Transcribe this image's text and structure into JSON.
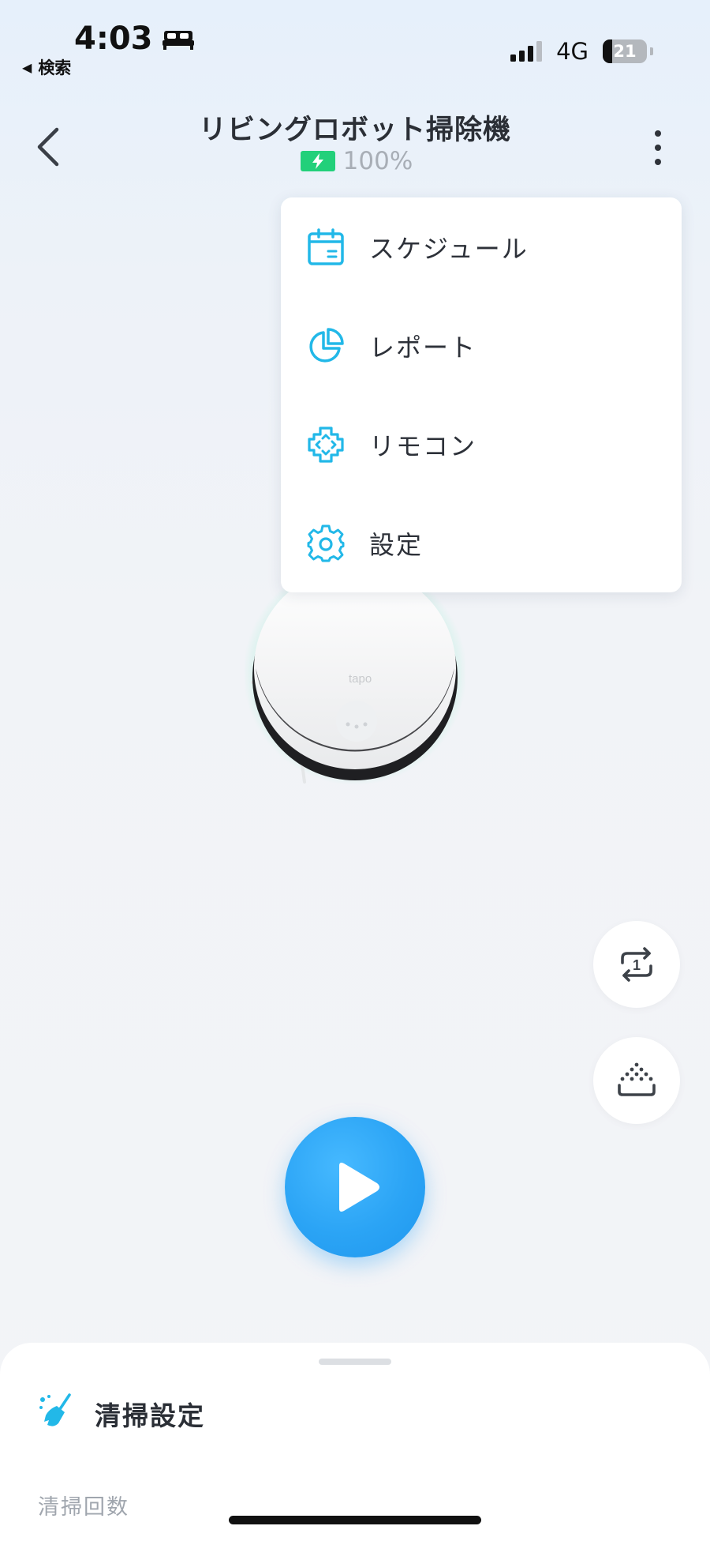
{
  "status_bar": {
    "time": "4:03",
    "back_app_label": "検索",
    "network": "4G",
    "battery_level": "21"
  },
  "header": {
    "title": "リビングロボット掃除機",
    "battery_percent": "100%"
  },
  "menu": {
    "items": [
      {
        "label": "スケジュール",
        "icon": "calendar-icon"
      },
      {
        "label": "レポート",
        "icon": "pie-chart-icon"
      },
      {
        "label": "リモコン",
        "icon": "remote-control-icon"
      },
      {
        "label": "設定",
        "icon": "gear-icon"
      }
    ]
  },
  "robot": {
    "brand_text": "tapo"
  },
  "side_actions": [
    {
      "name": "repeat-once-button",
      "icon": "repeat-once-icon",
      "badge": "1"
    },
    {
      "name": "suction-button",
      "icon": "suction-icon"
    }
  ],
  "sheet": {
    "title": "清掃設定",
    "subtitle": "清掃回数"
  },
  "colors": {
    "accent": "#2ba4f5",
    "icon_cyan": "#22b8e8",
    "charge_green": "#22d07a"
  }
}
